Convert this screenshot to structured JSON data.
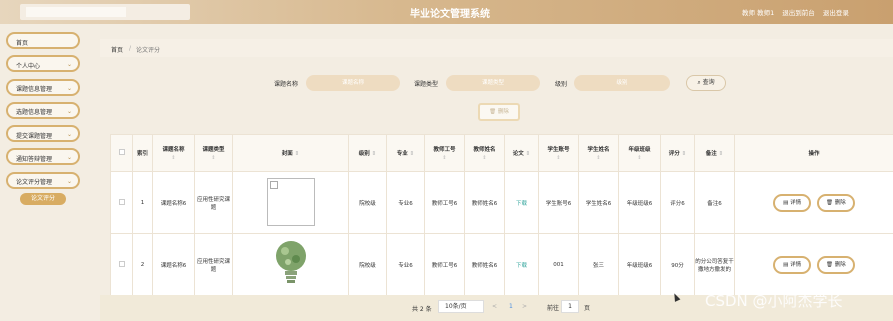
{
  "header": {
    "title": "毕业论文管理系统",
    "user_role": "教师 教师1",
    "back_label": "退出到前台",
    "logout_label": "退出登录"
  },
  "sidebar": {
    "items": [
      {
        "label": "首页",
        "chevron": false
      },
      {
        "label": "个人中心",
        "chevron": true
      },
      {
        "label": "课题信息管理",
        "chevron": true
      },
      {
        "label": "选题信息管理",
        "chevron": true
      },
      {
        "label": "提交课题管理",
        "chevron": true
      },
      {
        "label": "通知答辩管理",
        "chevron": true
      },
      {
        "label": "论文评分管理",
        "chevron": true
      }
    ],
    "active_sub": "论文评分"
  },
  "breadcrumb": {
    "home": "首页",
    "sep": "/",
    "current": "论文评分"
  },
  "search": {
    "name_label": "课题名称",
    "name_placeholder": "课题名称",
    "type_label": "课题类型",
    "type_placeholder": "课题类型",
    "level_label": "级别",
    "level_placeholder": "级别",
    "query_label": "查询"
  },
  "delete_label": "删除",
  "table": {
    "headers": {
      "index": "索引",
      "name": "课题名称",
      "type": "课题类型",
      "cover": "封面",
      "level": "级别",
      "major": "专业",
      "teacher_no": "教师工号",
      "teacher_name": "教师姓名",
      "paper": "论文",
      "student_no": "学生账号",
      "student_name": "学生姓名",
      "grade": "年级班级",
      "score": "评分",
      "remark": "备注",
      "ops": "操作"
    },
    "rows": [
      {
        "index": "1",
        "name": "课题名称6",
        "type": "应用性研究课题",
        "level": "院校级",
        "major": "专业6",
        "teacher_no": "教师工号6",
        "teacher_name": "教师姓名6",
        "paper": "下载",
        "student_no": "学生账号6",
        "student_name": "学生姓名6",
        "grade": "年级班级6",
        "score": "评分6",
        "remark": "备注6"
      },
      {
        "index": "2",
        "name": "课题名称6",
        "type": "应用性研究课题",
        "level": "院校级",
        "major": "专业6",
        "teacher_no": "教师工号6",
        "teacher_name": "教师姓名6",
        "paper": "下载",
        "student_no": "001",
        "student_name": "张三",
        "grade": "年级班级6",
        "score": "90分",
        "remark": "的分公司答复干撒地方撒发的"
      }
    ],
    "detail_label": "详情",
    "delete_label": "删除"
  },
  "pagination": {
    "total": "共 2 条",
    "size": "10条/页",
    "prev": "<",
    "page": "1",
    "next": ">",
    "goto": "前往",
    "goto_value": "1",
    "page_suffix": "页"
  },
  "watermark": "CSDN @小阿杰学长"
}
